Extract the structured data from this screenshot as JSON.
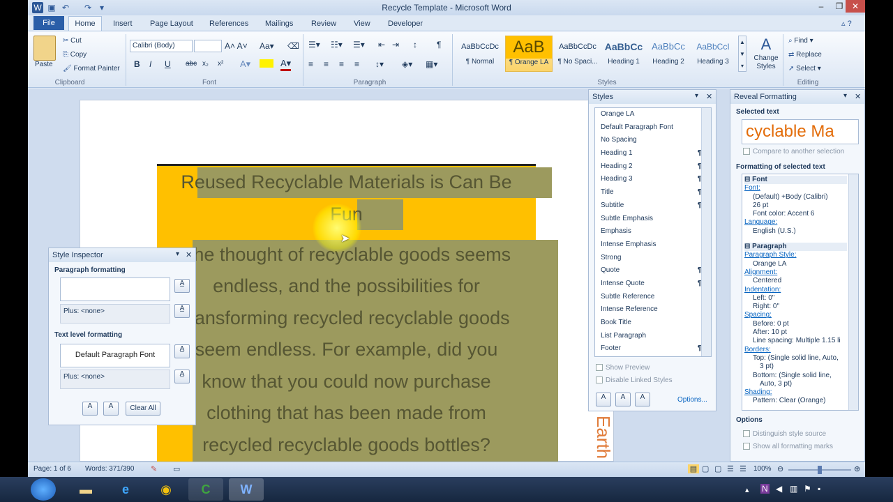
{
  "window": {
    "title": "Recycle Template - Microsoft Word"
  },
  "tabs": [
    "File",
    "Home",
    "Insert",
    "Page Layout",
    "References",
    "Mailings",
    "Review",
    "View",
    "Developer"
  ],
  "clipboard": {
    "paste": "Paste",
    "cut": "Cut",
    "copy": "Copy",
    "format_painter": "Format Painter",
    "label": "Clipboard"
  },
  "font": {
    "name": "Calibri (Body)",
    "size": "",
    "label": "Font",
    "buttons": [
      "B",
      "I",
      "U",
      "abc",
      "x₂",
      "x²"
    ]
  },
  "paragraph": {
    "label": "Paragraph"
  },
  "styles": {
    "label": "Styles",
    "gallery": [
      {
        "preview": "AaBbCcDc",
        "name": "¶ Normal"
      },
      {
        "preview": "AaB",
        "name": "¶ Orange LA"
      },
      {
        "preview": "AaBbCcDc",
        "name": "¶ No Spaci..."
      },
      {
        "preview": "AaBbCc",
        "name": "Heading 1"
      },
      {
        "preview": "AaBbCc",
        "name": "Heading 2"
      },
      {
        "preview": "AaBbCcI",
        "name": "Heading 3"
      }
    ],
    "change": "Change Styles"
  },
  "editing": {
    "find": "Find",
    "replace": "Replace",
    "select": "Select",
    "label": "Editing"
  },
  "document": {
    "lines": [
      "Reused Recyclable Materials is Can Be",
      "Fun",
      "The thought of recyclable goods seems",
      "endless, and the possibilities for",
      "transforming recycled recyclable goods",
      "seem endless.  For example, did you",
      "know that you could now purchase",
      "clothing that has been made from",
      "recycled recyclable goods bottles?"
    ],
    "side_text": "Earth"
  },
  "style_inspector": {
    "title": "Style Inspector",
    "para_label": "Paragraph formatting",
    "para_value": "",
    "para_plus": "Plus: <none>",
    "text_label": "Text level formatting",
    "text_value": "Default Paragraph Font",
    "text_plus": "Plus: <none>",
    "clear_all": "Clear All"
  },
  "styles_pane": {
    "title": "Styles",
    "items": [
      {
        "name": "Orange LA",
        "mark": "¶"
      },
      {
        "name": "Default Paragraph Font",
        "mark": "a"
      },
      {
        "name": "No Spacing",
        "mark": "¶"
      },
      {
        "name": "Heading 1",
        "mark": "¶a"
      },
      {
        "name": "Heading 2",
        "mark": "¶a"
      },
      {
        "name": "Heading 3",
        "mark": "¶a"
      },
      {
        "name": "Title",
        "mark": "¶a"
      },
      {
        "name": "Subtitle",
        "mark": "¶a"
      },
      {
        "name": "Subtle Emphasis",
        "mark": "a"
      },
      {
        "name": "Emphasis",
        "mark": "a"
      },
      {
        "name": "Intense Emphasis",
        "mark": "a"
      },
      {
        "name": "Strong",
        "mark": "a"
      },
      {
        "name": "Quote",
        "mark": "¶a"
      },
      {
        "name": "Intense Quote",
        "mark": "¶a"
      },
      {
        "name": "Subtle Reference",
        "mark": "a"
      },
      {
        "name": "Intense Reference",
        "mark": "a"
      },
      {
        "name": "Book Title",
        "mark": "a"
      },
      {
        "name": "List Paragraph",
        "mark": "¶"
      },
      {
        "name": "Footer",
        "mark": "¶a"
      }
    ],
    "show_preview": "Show Preview",
    "disable_linked": "Disable Linked Styles",
    "options": "Options..."
  },
  "reveal": {
    "title": "Reveal Formatting",
    "selected_label": "Selected text",
    "selected_value": "cyclable Ma",
    "compare": "Compare to another selection",
    "fmt_label": "Formatting of selected text",
    "font_head": "Font",
    "font_link": "Font:",
    "font_lines": [
      "(Default) +Body (Calibri)",
      "26 pt",
      "Font color: Accent 6"
    ],
    "lang_link": "Language:",
    "lang_value": "English (U.S.)",
    "para_head": "Paragraph",
    "pstyle_link": "Paragraph Style:",
    "pstyle_value": "Orange LA",
    "align_link": "Alignment:",
    "align_value": "Centered",
    "indent_link": "Indentation:",
    "indent_lines": [
      "Left:  0\"",
      "Right:  0\""
    ],
    "spacing_link": "Spacing:",
    "spacing_lines": [
      "Before:  0 pt",
      "After:  10 pt",
      "Line spacing:  Multiple 1.15 li"
    ],
    "borders_link": "Borders:",
    "borders_lines": [
      "Top: (Single solid line, Auto,",
      "3 pt)",
      "Bottom: (Single solid line,",
      "Auto,  3 pt)"
    ],
    "shading_link": "Shading:",
    "shading_value": "Pattern: Clear (Orange)",
    "options_label": "Options",
    "opt1": "Distinguish style source",
    "opt2": "Show all formatting marks"
  },
  "status": {
    "page": "Page: 1 of 6",
    "words": "Words: 371/390",
    "zoom": "100%"
  },
  "taskbar": {
    "time": ""
  }
}
